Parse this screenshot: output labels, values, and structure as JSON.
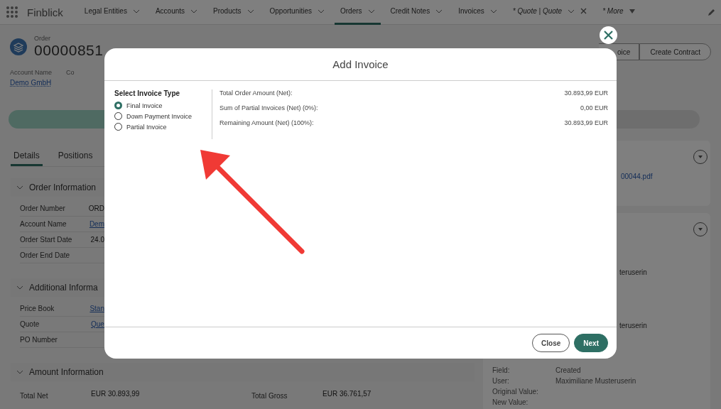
{
  "nav": {
    "app_name": "Finblick",
    "tabs": [
      {
        "label": "Legal Entities",
        "selected": false,
        "kind": "menu"
      },
      {
        "label": "Accounts",
        "selected": false,
        "kind": "menu"
      },
      {
        "label": "Products",
        "selected": false,
        "kind": "menu"
      },
      {
        "label": "Opportunities",
        "selected": false,
        "kind": "menu"
      },
      {
        "label": "Orders",
        "selected": true,
        "kind": "menu"
      },
      {
        "label": "Credit Notes",
        "selected": false,
        "kind": "menu"
      },
      {
        "label": "Invoices",
        "selected": false,
        "kind": "menu"
      },
      {
        "label": "* Quote | Quote",
        "selected": false,
        "kind": "closable"
      },
      {
        "label": "* More",
        "selected": false,
        "kind": "more"
      }
    ]
  },
  "record": {
    "object": "Order",
    "number": "00000851",
    "fields": [
      {
        "label": "Account Name",
        "value": "Demo GmbH"
      },
      {
        "label": "Co"
      }
    ],
    "actions": [
      "oice",
      "Create Contract"
    ]
  },
  "detail_tabs": [
    {
      "label": "Details",
      "selected": true
    },
    {
      "label": "Positions",
      "selected": false
    }
  ],
  "sections": [
    {
      "title": "Order Information",
      "expanded": true,
      "rows": [
        {
          "label": "Order Number",
          "value": "ORD",
          "link": false
        },
        {
          "label": "Account Name",
          "value": "Dem",
          "link": true
        },
        {
          "label": "Order Start Date",
          "value": "24.0",
          "link": false
        },
        {
          "label": "Order End Date"
        }
      ]
    },
    {
      "title": "Additional Informa",
      "expanded": true,
      "rows": [
        {
          "label": "Price Book",
          "value": "Stan",
          "link": true
        },
        {
          "label": "Quote",
          "value": "Que",
          "link": true
        },
        {
          "label": "PO Number"
        }
      ]
    },
    {
      "title": "Amount Information",
      "expanded": true,
      "pairs": [
        {
          "label": "Total Net",
          "value": "EUR 30.893,99"
        },
        {
          "label": "Total Gross",
          "value": "EUR 36.761,57"
        }
      ]
    }
  ],
  "side": {
    "file": "00044.pdf",
    "history_fragments": [
      "teruserin",
      "teruserin"
    ],
    "history_entry": [
      {
        "label": "Field:",
        "value": "Created"
      },
      {
        "label": "User:",
        "value": "Maximiliane Musteruserin"
      },
      {
        "label": "Original Value:"
      },
      {
        "label": "New Value:"
      }
    ]
  },
  "modal": {
    "title": "Add Invoice",
    "type_heading": "Select Invoice Type",
    "types": [
      {
        "label": "Final Invoice",
        "selected": true
      },
      {
        "label": "Down Payment Invoice",
        "selected": false
      },
      {
        "label": "Partial Invoice",
        "selected": false
      }
    ],
    "amounts": [
      {
        "label": "Total Order Amount (Net):",
        "value": "30.893,99 EUR"
      },
      {
        "label": "Sum of Partial Invoices (Net) (0%):",
        "value": "0,00 EUR"
      },
      {
        "label": "Remaining Amount (Net) (100%):",
        "value": "30.893,99 EUR"
      }
    ],
    "buttons": [
      {
        "label": "Close",
        "kind": "secondary"
      },
      {
        "label": "Next",
        "kind": "primary"
      }
    ]
  }
}
